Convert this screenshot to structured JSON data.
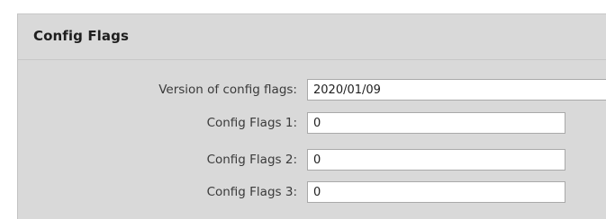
{
  "section": {
    "title": "Config Flags"
  },
  "fields": [
    {
      "label": "Version of config flags:",
      "value": "2020/01/09"
    },
    {
      "label": "Config Flags 1:",
      "value": "0"
    },
    {
      "label": "Config Flags 2:",
      "value": "0"
    },
    {
      "label": "Config Flags 3:",
      "value": "0"
    }
  ]
}
